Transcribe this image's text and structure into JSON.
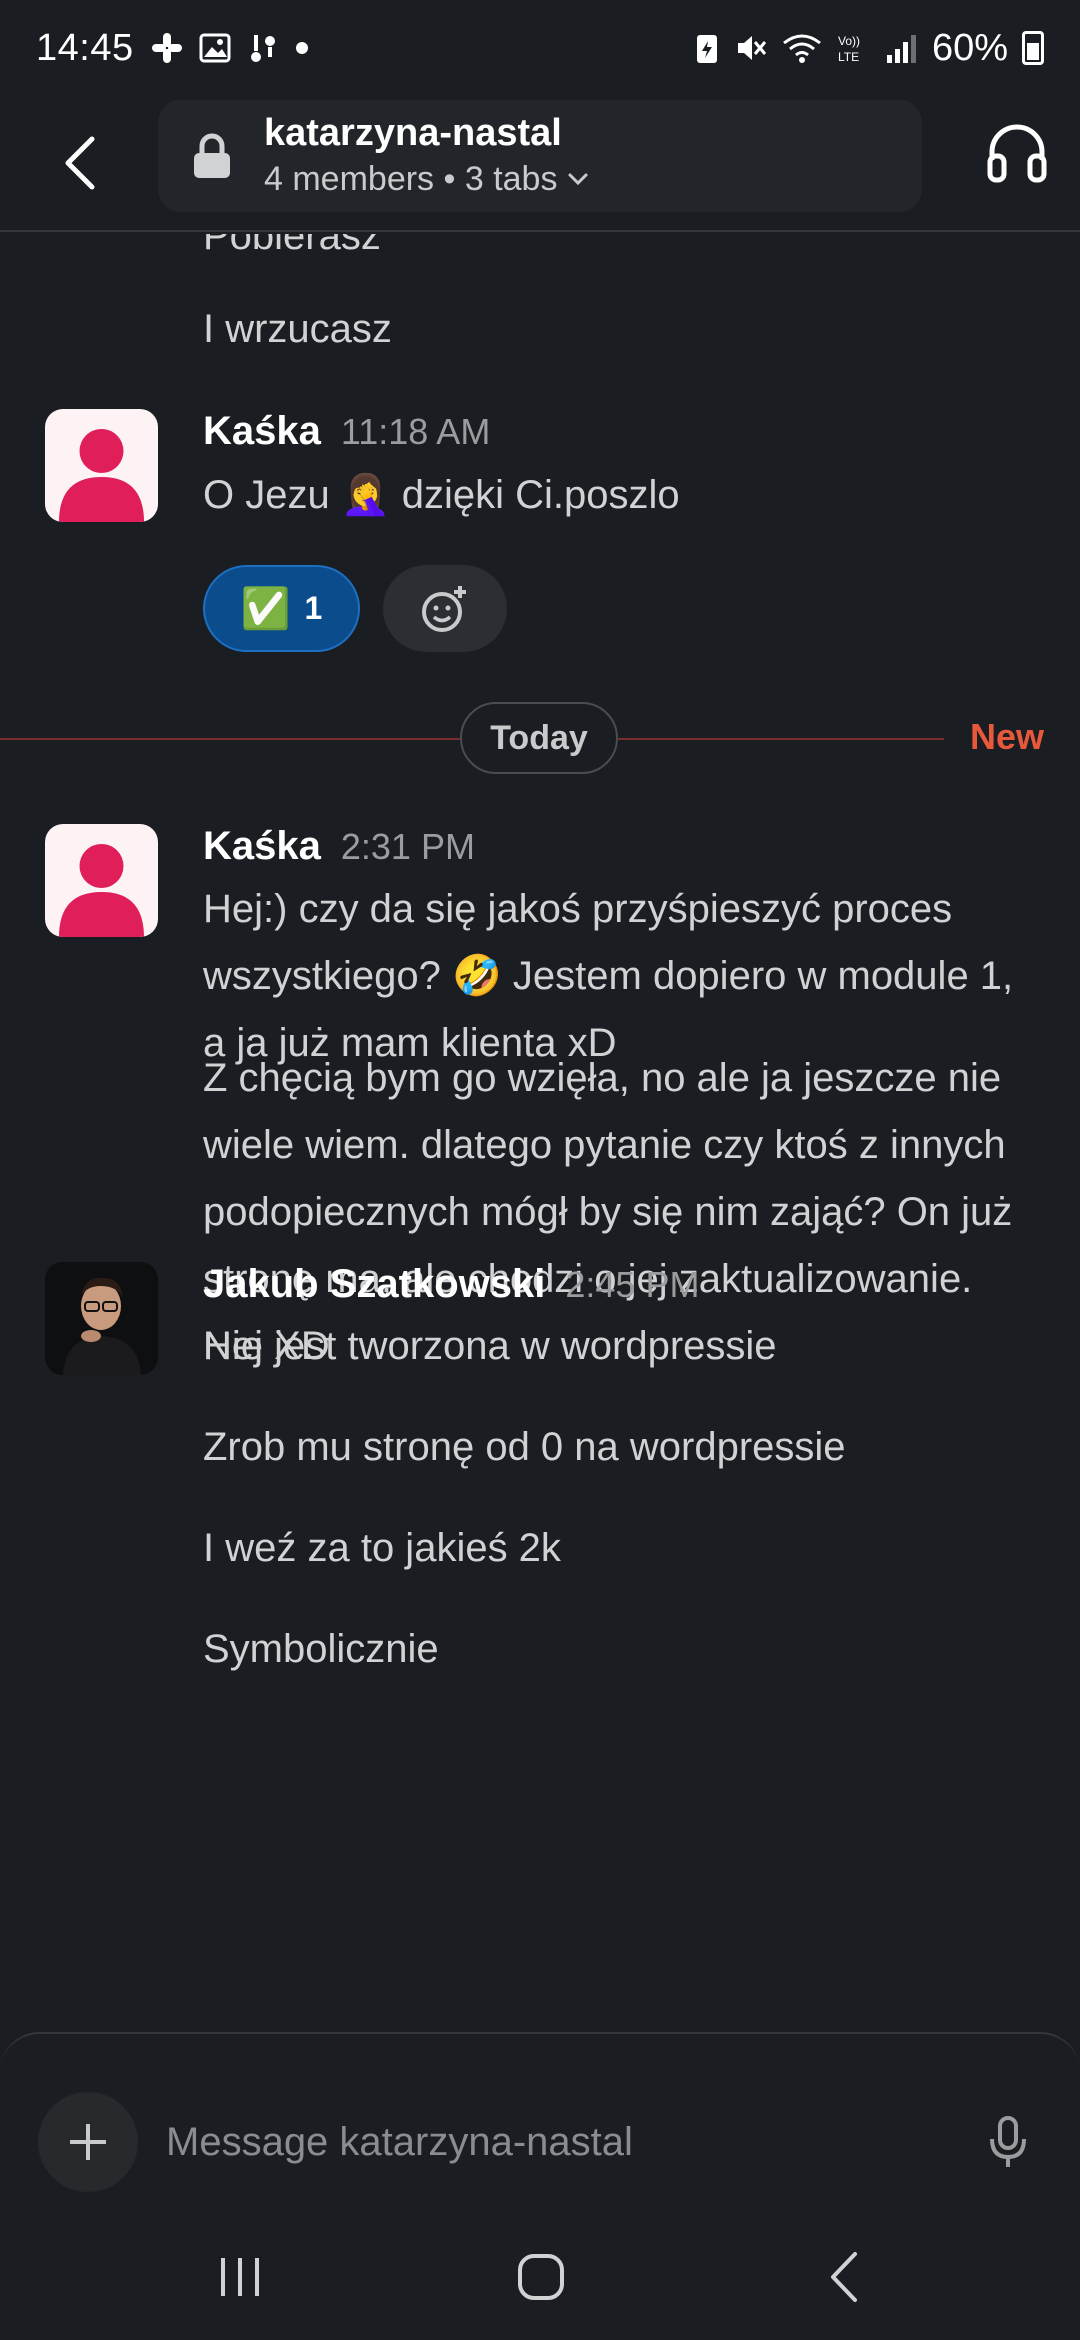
{
  "status_bar": {
    "time": "14:45",
    "battery": "60%",
    "left_icons": [
      "slack-icon",
      "gallery-icon",
      "voicemail-icon",
      "dot-icon"
    ],
    "right_icons": [
      "battery-saver-icon",
      "mute-icon",
      "wifi-icon",
      "volte-icon",
      "signal-icon"
    ]
  },
  "header": {
    "channel_name": "katarzyna-nastal",
    "channel_sub": "4 members • 3 tabs"
  },
  "messages": {
    "cut_text": "Pobierasz",
    "m0_text": "I wrzucasz",
    "m1": {
      "author": "Kaśka",
      "time": "11:18 AM",
      "text": "O Jezu 🤦‍♀️ dzięki Ci.poszlo",
      "reaction_emoji": "✅",
      "reaction_count": "1"
    },
    "divider": {
      "label": "Today",
      "new_label": "New"
    },
    "m2": {
      "author": "Kaśka",
      "time": "2:31 PM",
      "p1": "Hej:) czy da się jakoś przyśpieszyć proces wszystkiego? 🤣 Jestem dopiero w module 1, a ja już mam klienta xD",
      "p2": "Z chęcią bym go wzięła, no ale ja jeszcze nie wiele wiem. dlatego pytanie czy ktoś z innych podopiecznych mógł by się nim zająć? On już stronę ma, ale chodzi o jej zaktualizowanie. Nie jest tworzona w wordpressie"
    },
    "m3": {
      "author": "Jakub Szatkowski",
      "time": "2:45 PM",
      "l1": "Hej XD",
      "l2": "Zrob mu stronę od 0 na wordpressie",
      "l3": "I weź za to jakieś 2k",
      "l4": "Symbolicznie"
    }
  },
  "composer": {
    "placeholder": "Message katarzyna-nastal"
  },
  "colors": {
    "background": "#1a1d21",
    "reaction_bg": "#0b4d8c",
    "new_label": "#e8583a",
    "avatar_pink": "#e01e5a"
  }
}
